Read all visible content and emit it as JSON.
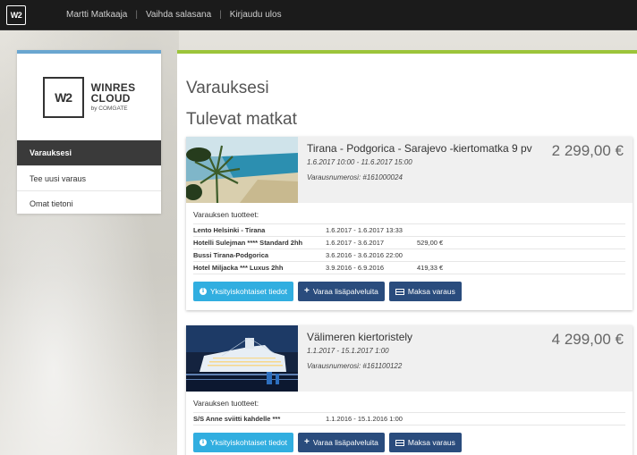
{
  "topbar": {
    "logo_text": "W2",
    "nav": [
      {
        "label": "Martti Matkaaja"
      },
      {
        "label": "Vaihda salasana"
      },
      {
        "label": "Kirjaudu ulos"
      }
    ],
    "separator": "|"
  },
  "sidebar": {
    "brand_mark": "W2",
    "brand_line1": "WINRES",
    "brand_line2": "CLOUD",
    "brand_sub": "by COMGATE",
    "items": [
      {
        "label": "Varauksesi",
        "active": true
      },
      {
        "label": "Tee uusi varaus",
        "active": false
      },
      {
        "label": "Omat tietoni",
        "active": false
      }
    ]
  },
  "main": {
    "title": "Varauksesi",
    "subtitle": "Tulevat matkat",
    "products_label": "Varauksen tuotteet:",
    "buttons": {
      "details": "Yksityiskohtaiset tiedot",
      "book_extra": "Varaa lisäpalveluita",
      "pay": "Maksa varaus"
    },
    "trips": [
      {
        "title": "Tirana - Podgorica - Sarajevo -kiertomatka 9 pv",
        "dates": "1.6.2017 10:00 - 11.6.2017 15:00",
        "ref": "Varausnumerosi: #161000024",
        "price": "2 299,00 €",
        "image": "beach-palm",
        "products": [
          {
            "name": "Lento Helsinki - Tirana",
            "dates": "1.6.2017 - 1.6.2017 13:33",
            "price": ""
          },
          {
            "name": "Hotelli Sulejman **** Standard 2hh",
            "dates": "1.6.2017 - 3.6.2017",
            "price": "529,00 €"
          },
          {
            "name": "Bussi Tirana-Podgorica",
            "dates": "3.6.2016 - 3.6.2016 22:00",
            "price": ""
          },
          {
            "name": "Hotel Miljacka *** Luxus 2hh",
            "dates": "3.9.2016 - 6.9.2016",
            "price": "419,33 €"
          }
        ]
      },
      {
        "title": "Välimeren kiertoristely",
        "dates": "1.1.2017 - 15.1.2017 1:00",
        "ref": "Varausnumerosi: #161100122",
        "price": "4 299,00 €",
        "image": "cruise-ship",
        "products": [
          {
            "name": "S/S Anne sviitti kahdelle ***",
            "dates": "1.1.2016 - 15.1.2016 1:00",
            "price": ""
          }
        ]
      }
    ]
  },
  "colors": {
    "topbar_bg": "#1b1b1b",
    "sidebar_accent": "#6aa6d0",
    "main_accent": "#9cc43a",
    "btn_info": "#31aee0",
    "btn_dark": "#2a4c7d",
    "nav_active_bg": "#3a3a3a"
  }
}
